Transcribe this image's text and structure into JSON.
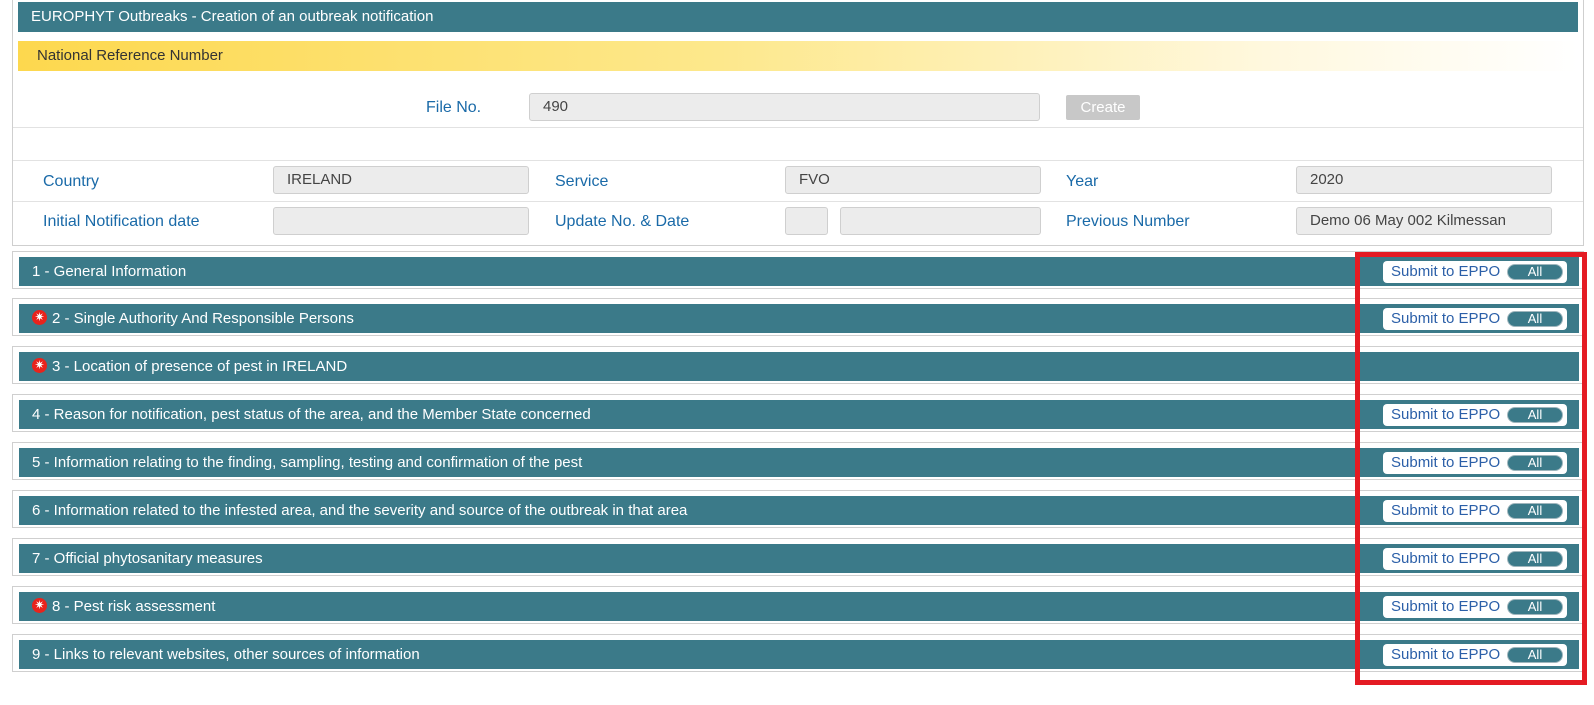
{
  "header": {
    "title": "EUROPHYT Outbreaks - Creation of an outbreak notification",
    "national_reference": "National Reference Number"
  },
  "file": {
    "label": "File No.",
    "value": "490",
    "create_label": "Create"
  },
  "details": {
    "country_label": "Country",
    "country_value": "IRELAND",
    "service_label": "Service",
    "service_value": "FVO",
    "year_label": "Year",
    "year_value": "2020",
    "initial_date_label": "Initial Notification date",
    "initial_date_value": "",
    "update_label": "Update No. & Date",
    "update_no": "",
    "update_date": "",
    "previous_label": "Previous Number",
    "previous_value": "Demo 06 May 002 Kilmessan"
  },
  "sections": [
    {
      "label": "1 - General Information",
      "required": false,
      "submit": true
    },
    {
      "label": "2 - Single Authority And Responsible Persons",
      "required": true,
      "submit": true
    },
    {
      "label": "3 - Location of presence of pest in IRELAND",
      "required": true,
      "submit": false
    },
    {
      "label": "4 - Reason for notification, pest status of the area, and the Member State concerned",
      "required": false,
      "submit": true
    },
    {
      "label": "5 - Information relating to the finding, sampling, testing and confirmation of the pest",
      "required": false,
      "submit": true
    },
    {
      "label": "6 - Information related to the infested area, and the severity and source of the outbreak in that area",
      "required": false,
      "submit": true
    },
    {
      "label": "7 - Official phytosanitary measures",
      "required": false,
      "submit": true
    },
    {
      "label": "8 - Pest risk assessment",
      "required": true,
      "submit": true
    },
    {
      "label": "9 - Links to relevant websites, other sources of information",
      "required": false,
      "submit": true
    }
  ],
  "submit_label": "Submit to EPPO",
  "toggle_label": "All",
  "colors": {
    "header": "#3b7a89",
    "accent_yellow": "#fdd84e",
    "label_blue": "#1a6aa8",
    "required_red": "#e8231c",
    "highlight_box": "#e41b23"
  }
}
